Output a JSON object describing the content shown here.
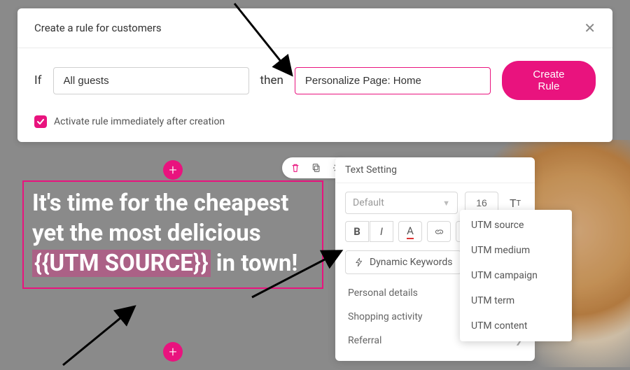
{
  "rule_panel": {
    "title": "Create a rule for customers",
    "if_label": "If",
    "if_value": "All guests",
    "then_label": "then",
    "then_value": "Personalize Page: Home",
    "create_btn": "Create Rule",
    "activate_label": "Activate rule immediately after creation",
    "activate_checked": true
  },
  "heading": {
    "pre": "It's time for the cheapest yet the most delicious ",
    "token": "{{UTM SOURCE}}",
    "post": " in town!"
  },
  "text_setting": {
    "title": "Text Setting",
    "font_family": "Default",
    "font_size": "16",
    "dyn_kw_btn": "Dynamic Keywords",
    "categories": [
      "Personal details",
      "Shopping activity",
      "Referral"
    ]
  },
  "utm_menu": {
    "items": [
      "UTM source",
      "UTM medium",
      "UTM campaign",
      "UTM term",
      "UTM content"
    ]
  }
}
